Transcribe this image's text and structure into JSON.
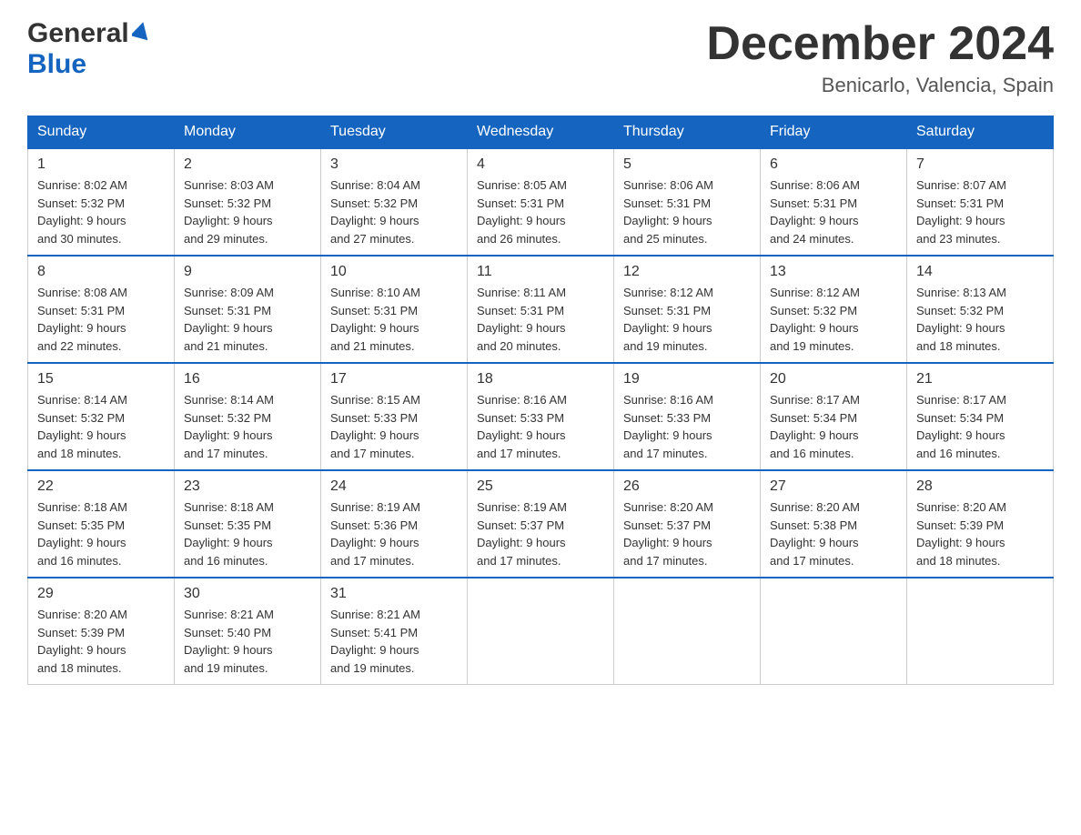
{
  "header": {
    "logo_general": "General",
    "logo_blue": "Blue",
    "title": "December 2024",
    "location": "Benicarlo, Valencia, Spain"
  },
  "days_of_week": [
    "Sunday",
    "Monday",
    "Tuesday",
    "Wednesday",
    "Thursday",
    "Friday",
    "Saturday"
  ],
  "weeks": [
    [
      {
        "day": "1",
        "sunrise": "8:02 AM",
        "sunset": "5:32 PM",
        "daylight": "9 hours and 30 minutes."
      },
      {
        "day": "2",
        "sunrise": "8:03 AM",
        "sunset": "5:32 PM",
        "daylight": "9 hours and 29 minutes."
      },
      {
        "day": "3",
        "sunrise": "8:04 AM",
        "sunset": "5:32 PM",
        "daylight": "9 hours and 27 minutes."
      },
      {
        "day": "4",
        "sunrise": "8:05 AM",
        "sunset": "5:31 PM",
        "daylight": "9 hours and 26 minutes."
      },
      {
        "day": "5",
        "sunrise": "8:06 AM",
        "sunset": "5:31 PM",
        "daylight": "9 hours and 25 minutes."
      },
      {
        "day": "6",
        "sunrise": "8:06 AM",
        "sunset": "5:31 PM",
        "daylight": "9 hours and 24 minutes."
      },
      {
        "day": "7",
        "sunrise": "8:07 AM",
        "sunset": "5:31 PM",
        "daylight": "9 hours and 23 minutes."
      }
    ],
    [
      {
        "day": "8",
        "sunrise": "8:08 AM",
        "sunset": "5:31 PM",
        "daylight": "9 hours and 22 minutes."
      },
      {
        "day": "9",
        "sunrise": "8:09 AM",
        "sunset": "5:31 PM",
        "daylight": "9 hours and 21 minutes."
      },
      {
        "day": "10",
        "sunrise": "8:10 AM",
        "sunset": "5:31 PM",
        "daylight": "9 hours and 21 minutes."
      },
      {
        "day": "11",
        "sunrise": "8:11 AM",
        "sunset": "5:31 PM",
        "daylight": "9 hours and 20 minutes."
      },
      {
        "day": "12",
        "sunrise": "8:12 AM",
        "sunset": "5:31 PM",
        "daylight": "9 hours and 19 minutes."
      },
      {
        "day": "13",
        "sunrise": "8:12 AM",
        "sunset": "5:32 PM",
        "daylight": "9 hours and 19 minutes."
      },
      {
        "day": "14",
        "sunrise": "8:13 AM",
        "sunset": "5:32 PM",
        "daylight": "9 hours and 18 minutes."
      }
    ],
    [
      {
        "day": "15",
        "sunrise": "8:14 AM",
        "sunset": "5:32 PM",
        "daylight": "9 hours and 18 minutes."
      },
      {
        "day": "16",
        "sunrise": "8:14 AM",
        "sunset": "5:32 PM",
        "daylight": "9 hours and 17 minutes."
      },
      {
        "day": "17",
        "sunrise": "8:15 AM",
        "sunset": "5:33 PM",
        "daylight": "9 hours and 17 minutes."
      },
      {
        "day": "18",
        "sunrise": "8:16 AM",
        "sunset": "5:33 PM",
        "daylight": "9 hours and 17 minutes."
      },
      {
        "day": "19",
        "sunrise": "8:16 AM",
        "sunset": "5:33 PM",
        "daylight": "9 hours and 17 minutes."
      },
      {
        "day": "20",
        "sunrise": "8:17 AM",
        "sunset": "5:34 PM",
        "daylight": "9 hours and 16 minutes."
      },
      {
        "day": "21",
        "sunrise": "8:17 AM",
        "sunset": "5:34 PM",
        "daylight": "9 hours and 16 minutes."
      }
    ],
    [
      {
        "day": "22",
        "sunrise": "8:18 AM",
        "sunset": "5:35 PM",
        "daylight": "9 hours and 16 minutes."
      },
      {
        "day": "23",
        "sunrise": "8:18 AM",
        "sunset": "5:35 PM",
        "daylight": "9 hours and 16 minutes."
      },
      {
        "day": "24",
        "sunrise": "8:19 AM",
        "sunset": "5:36 PM",
        "daylight": "9 hours and 17 minutes."
      },
      {
        "day": "25",
        "sunrise": "8:19 AM",
        "sunset": "5:37 PM",
        "daylight": "9 hours and 17 minutes."
      },
      {
        "day": "26",
        "sunrise": "8:20 AM",
        "sunset": "5:37 PM",
        "daylight": "9 hours and 17 minutes."
      },
      {
        "day": "27",
        "sunrise": "8:20 AM",
        "sunset": "5:38 PM",
        "daylight": "9 hours and 17 minutes."
      },
      {
        "day": "28",
        "sunrise": "8:20 AM",
        "sunset": "5:39 PM",
        "daylight": "9 hours and 18 minutes."
      }
    ],
    [
      {
        "day": "29",
        "sunrise": "8:20 AM",
        "sunset": "5:39 PM",
        "daylight": "9 hours and 18 minutes."
      },
      {
        "day": "30",
        "sunrise": "8:21 AM",
        "sunset": "5:40 PM",
        "daylight": "9 hours and 19 minutes."
      },
      {
        "day": "31",
        "sunrise": "8:21 AM",
        "sunset": "5:41 PM",
        "daylight": "9 hours and 19 minutes."
      },
      null,
      null,
      null,
      null
    ]
  ],
  "labels": {
    "sunrise": "Sunrise:",
    "sunset": "Sunset:",
    "daylight": "Daylight:"
  }
}
